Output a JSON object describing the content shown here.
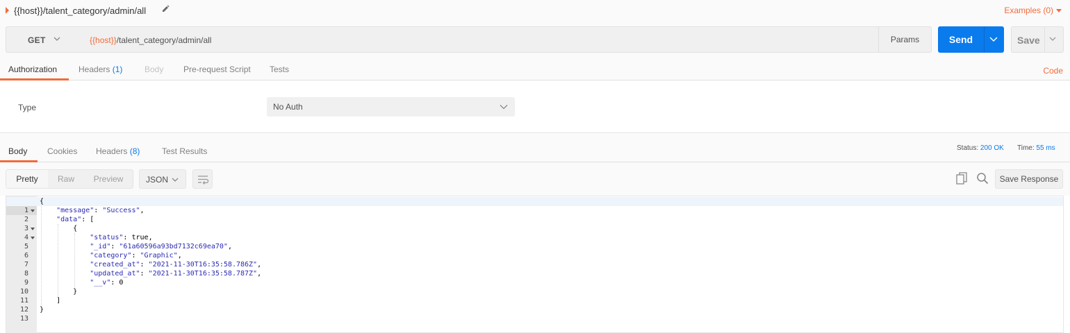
{
  "request": {
    "title": "{{host}}/talent_category/admin/all",
    "examples_label": "Examples (0)",
    "method": "GET",
    "url_host": "{{host}}",
    "url_path": "/talent_category/admin/all",
    "params_label": "Params",
    "send_label": "Send",
    "save_label": "Save"
  },
  "request_tabs": {
    "authorization": "Authorization",
    "headers": "Headers",
    "headers_count": "(1)",
    "body": "Body",
    "prerequest": "Pre-request Script",
    "tests": "Tests",
    "code": "Code"
  },
  "auth": {
    "type_label": "Type",
    "selected": "No Auth"
  },
  "response_tabs": {
    "body": "Body",
    "cookies": "Cookies",
    "headers": "Headers",
    "headers_count": "(8)",
    "test_results": "Test Results",
    "status_label": "Status:",
    "status_value": "200 OK",
    "time_label": "Time:",
    "time_value": "55 ms"
  },
  "response_toolbar": {
    "pretty": "Pretty",
    "raw": "Raw",
    "preview": "Preview",
    "format": "JSON",
    "save_response": "Save Response"
  },
  "editor": {
    "lines": [
      {
        "n": "1",
        "fold": true,
        "current": true
      },
      {
        "n": "2",
        "fold": false
      },
      {
        "n": "3",
        "fold": true
      },
      {
        "n": "4",
        "fold": true
      },
      {
        "n": "5",
        "fold": false
      },
      {
        "n": "6",
        "fold": false
      },
      {
        "n": "7",
        "fold": false
      },
      {
        "n": "8",
        "fold": false
      },
      {
        "n": "9",
        "fold": false
      },
      {
        "n": "10",
        "fold": false
      },
      {
        "n": "11",
        "fold": false
      },
      {
        "n": "12",
        "fold": false
      },
      {
        "n": "13",
        "fold": false
      }
    ],
    "code": {
      "l1": "{",
      "l2_key": "\"message\"",
      "l2_val": "\"Success\"",
      "l3_key": "\"data\"",
      "l3_open": "[",
      "l4": "{",
      "l5_key": "\"status\"",
      "l5_val": "true",
      "l6_key": "\"_id\"",
      "l6_val": "\"61a60596a93bd7132c69ea70\"",
      "l7_key": "\"category\"",
      "l7_val": "\"Graphic\"",
      "l8_key": "\"created_at\"",
      "l8_val": "\"2021-11-30T16:35:58.786Z\"",
      "l9_key": "\"updated_at\"",
      "l9_val": "\"2021-11-30T16:35:58.787Z\"",
      "l10_key": "\"__v\"",
      "l10_val": "0",
      "l11": "}",
      "l12": "]",
      "l13": "}"
    }
  },
  "colors": {
    "accent": "#f26b3a",
    "primary": "#097bed",
    "json_token": "#2a2ab4"
  }
}
